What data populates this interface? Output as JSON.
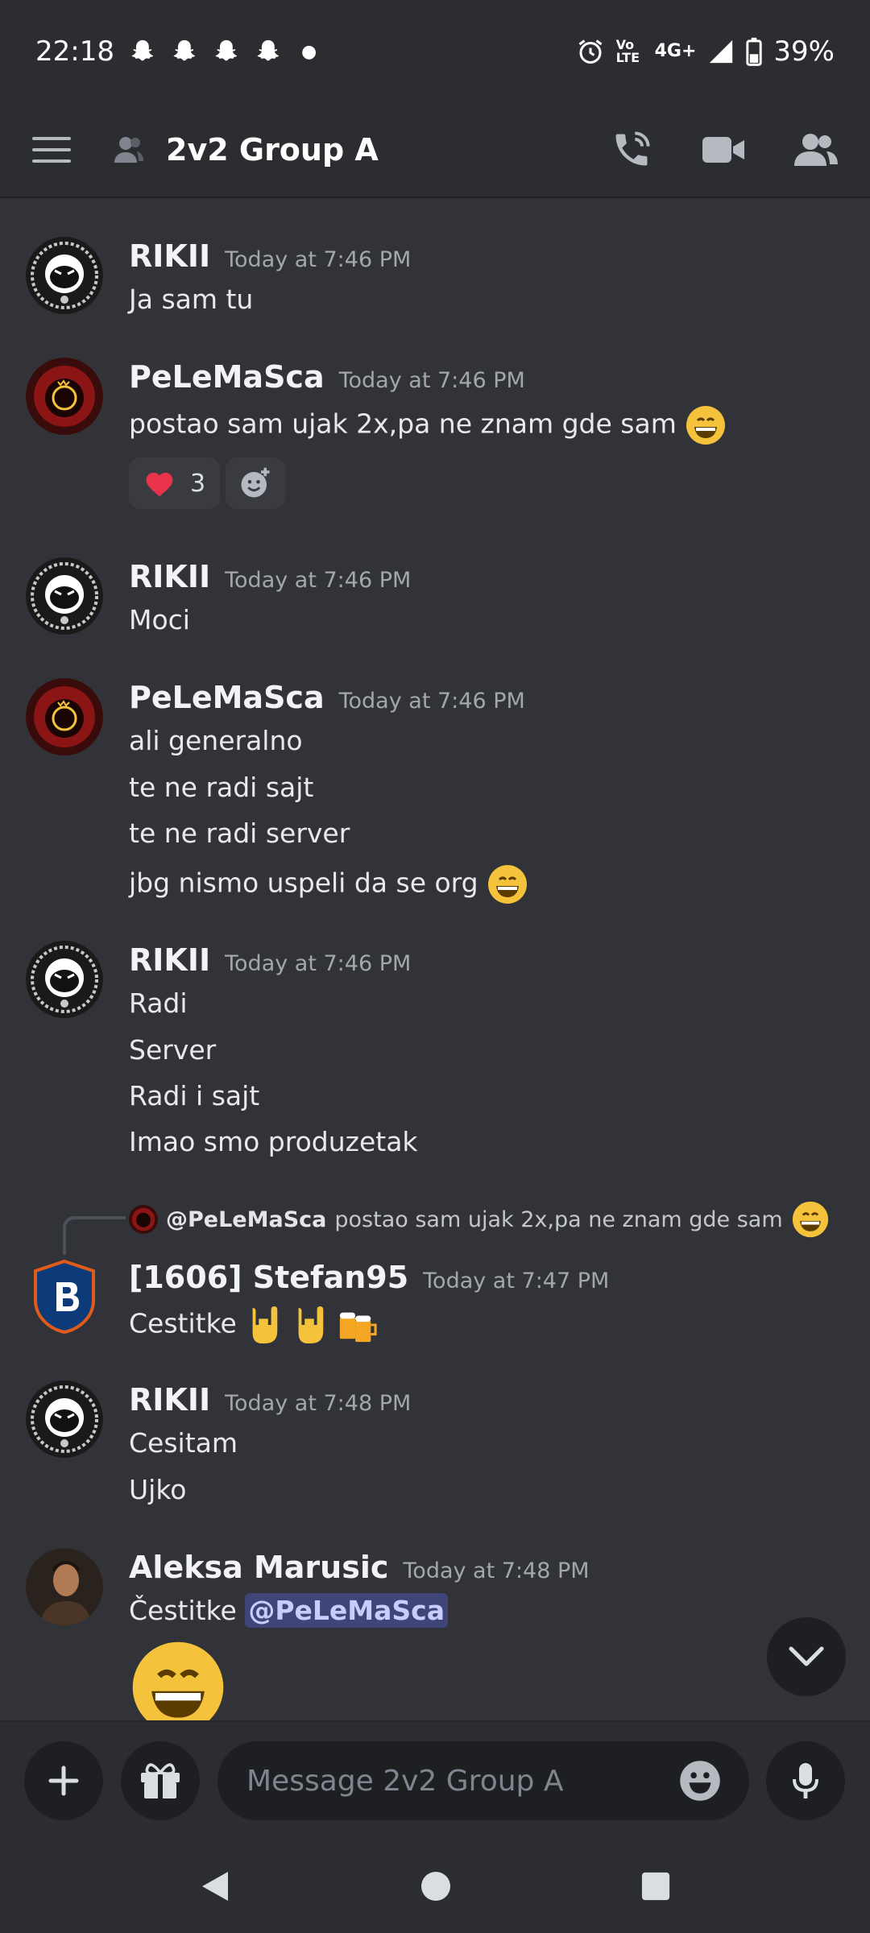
{
  "status_bar": {
    "time": "22:18",
    "network": "4G+",
    "lte": "Vo LTE",
    "battery": "39%"
  },
  "header": {
    "title": "2v2 Group A"
  },
  "messages": [
    {
      "author": "RIKII",
      "time": "Today at 7:46 PM",
      "lines": [
        "Ja sam tu"
      ]
    },
    {
      "author": "PeLeMaSca",
      "time": "Today at 7:46 PM",
      "lines": [
        "postao sam ujak 2x,pa ne znam gde sam"
      ],
      "reaction": {
        "emoji": "heart",
        "count": "3"
      }
    },
    {
      "author": "RIKII",
      "time": "Today at 7:46 PM",
      "lines": [
        "Moci"
      ]
    },
    {
      "author": "PeLeMaSca",
      "time": "Today at 7:46 PM",
      "lines": [
        "ali generalno",
        "te ne radi sajt",
        "te ne radi server",
        "jbg nismo uspeli da se org"
      ]
    },
    {
      "author": "RIKII",
      "time": "Today at 7:46 PM",
      "lines": [
        "Radi",
        "Server",
        "Radi i sajt",
        "Imao smo produzetak"
      ]
    },
    {
      "author": "[1606] Stefan95",
      "time": "Today at 7:47 PM",
      "lines": [
        "Cestitke"
      ],
      "reply": {
        "author": "@PeLeMaSca",
        "text": "postao sam ujak 2x,pa ne znam gde sam"
      }
    },
    {
      "author": "RIKII",
      "time": "Today at 7:48 PM",
      "lines": [
        "Cesitam",
        "Ujko"
      ]
    },
    {
      "author": "Aleksa Marusic",
      "time": "Today at 7:48 PM",
      "lines": [
        "Čestitke"
      ],
      "mention": "@PeLeMaSca"
    }
  ],
  "composer": {
    "placeholder": "Message 2v2 Group A"
  },
  "colors": {
    "background": "#313338",
    "header": "#2b2d31",
    "mention_bg": "#3f4479",
    "heart": "#e8334a",
    "emoji_yellow": "#f5c33b"
  }
}
